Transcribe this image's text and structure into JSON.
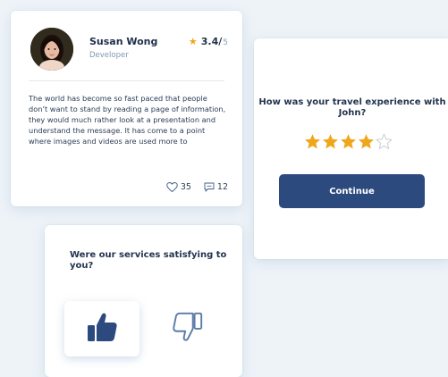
{
  "review": {
    "name": "Susan Wong",
    "role": "Developer",
    "rating": "3.4/",
    "rating_max": "5",
    "text": "The world has become so fast paced that people don’t want to stand by reading a page of information, they would much rather look at a presentation and understand the message. It has come to a point where images and videos are used more to",
    "likes": "35",
    "comments": "12",
    "icons": {
      "rating": "star-icon",
      "likes": "heart-icon",
      "comments": "comment-icon"
    }
  },
  "travel": {
    "question": "How was your travel experience with John?",
    "rating": 4,
    "rating_max": 5,
    "button_label": "Continue"
  },
  "services": {
    "question": "Were our services satisfying to you?",
    "options": [
      {
        "name": "thumbs-up-icon",
        "selected": true
      },
      {
        "name": "thumbs-down-icon",
        "selected": false
      }
    ]
  },
  "colors": {
    "accent": "#2d4a7e",
    "star": "#f0a61c",
    "star_empty": "#c8d0da",
    "background": "#eef3f8"
  }
}
